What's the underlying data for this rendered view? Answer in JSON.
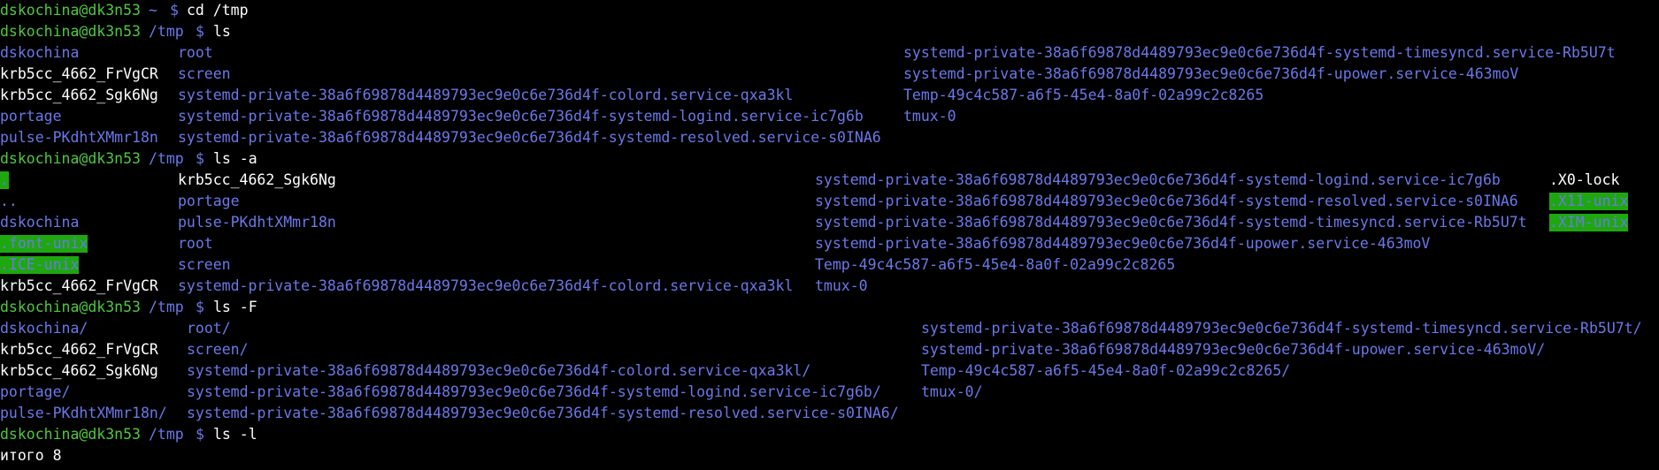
{
  "prompt": {
    "user_host": "dskochina@dk3n53",
    "dollar": "$"
  },
  "lines": [
    {
      "path": "~",
      "command": "cd /tmp"
    },
    {
      "path": "/tmp",
      "command": "ls"
    },
    {
      "path": "/tmp",
      "command": "ls -a"
    },
    {
      "path": "/tmp",
      "command": "ls -F"
    },
    {
      "path": "/tmp",
      "command": "ls -l"
    }
  ],
  "ls": {
    "col1": [
      "dskochina",
      "krb5cc_4662_FrVgCR",
      "krb5cc_4662_Sgk6Ng",
      "portage",
      "pulse-PKdhtXMmr18n"
    ],
    "col2": [
      "root",
      "screen",
      "systemd-private-38a6f69878d4489793ec9e0c6e736d4f-colord.service-qxa3kl",
      "systemd-private-38a6f69878d4489793ec9e0c6e736d4f-systemd-logind.service-ic7g6b",
      "systemd-private-38a6f69878d4489793ec9e0c6e736d4f-systemd-resolved.service-s0INA6"
    ],
    "col3": [
      "systemd-private-38a6f69878d4489793ec9e0c6e736d4f-systemd-timesyncd.service-Rb5U7t",
      "systemd-private-38a6f69878d4489793ec9e0c6e736d4f-upower.service-463moV",
      "Temp-49c4c587-a6f5-45e4-8a0f-02a99c2c8265",
      "tmux-0"
    ]
  },
  "ls_a": {
    "col1": [
      ".",
      "..",
      "dskochina",
      ".font-unix",
      ".ICE-unix",
      "krb5cc_4662_FrVgCR"
    ],
    "col2": [
      "krb5cc_4662_Sgk6Ng",
      "portage",
      "pulse-PKdhtXMmr18n",
      "root",
      "screen",
      "systemd-private-38a6f69878d4489793ec9e0c6e736d4f-colord.service-qxa3kl"
    ],
    "col3": [
      "systemd-private-38a6f69878d4489793ec9e0c6e736d4f-systemd-logind.service-ic7g6b",
      "systemd-private-38a6f69878d4489793ec9e0c6e736d4f-systemd-resolved.service-s0INA6",
      "systemd-private-38a6f69878d4489793ec9e0c6e736d4f-systemd-timesyncd.service-Rb5U7t",
      "systemd-private-38a6f69878d4489793ec9e0c6e736d4f-upower.service-463moV",
      "Temp-49c4c587-a6f5-45e4-8a0f-02a99c2c8265",
      "tmux-0"
    ],
    "col4": [
      ".X0-lock",
      ".X11-unix",
      ".XIM-unix"
    ]
  },
  "ls_F": {
    "col1": [
      "dskochina/",
      "krb5cc_4662_FrVgCR",
      "krb5cc_4662_Sgk6Ng",
      "portage/",
      "pulse-PKdhtXMmr18n/"
    ],
    "col2": [
      "root/",
      "screen/",
      "systemd-private-38a6f69878d4489793ec9e0c6e736d4f-colord.service-qxa3kl/",
      "systemd-private-38a6f69878d4489793ec9e0c6e736d4f-systemd-logind.service-ic7g6b/",
      "systemd-private-38a6f69878d4489793ec9e0c6e736d4f-systemd-resolved.service-s0INA6/"
    ],
    "col3": [
      "systemd-private-38a6f69878d4489793ec9e0c6e736d4f-systemd-timesyncd.service-Rb5U7t/",
      "systemd-private-38a6f69878d4489793ec9e0c6e736d4f-upower.service-463moV/",
      "Temp-49c4c587-a6f5-45e4-8a0f-02a99c2c8265/",
      "tmux-0/"
    ]
  },
  "ls_l": {
    "total": "итого 8"
  },
  "colors": {
    "background": "#000000",
    "prompt_user": "#4ec93e",
    "directory": "#6b78e8",
    "highlight_bg": "#1ea70f",
    "text": "#ffffff"
  }
}
